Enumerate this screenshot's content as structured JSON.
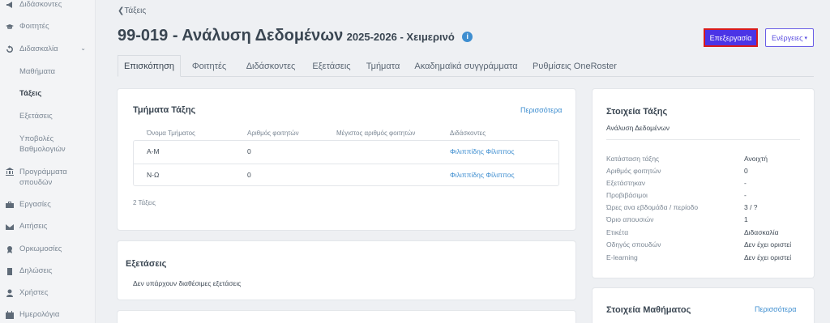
{
  "sidebar": {
    "items": [
      {
        "label": "Διδάσκοντες",
        "icon": "megaphone-icon"
      },
      {
        "label": "Φοιτητές",
        "icon": "graduation-cap-icon"
      },
      {
        "label": "Διδασκαλία",
        "icon": "refresh-icon"
      },
      {
        "label": "Προγράμματα σπουδών",
        "icon": "institution-icon"
      },
      {
        "label": "Εργασίες",
        "icon": "briefcase-icon"
      },
      {
        "label": "Αιτήσεις",
        "icon": "envelope-icon"
      },
      {
        "label": "Ορκωμοσίες",
        "icon": "certificate-icon"
      },
      {
        "label": "Δηλώσεις",
        "icon": "clipboard-icon"
      },
      {
        "label": "Χρήστες",
        "icon": "user-icon"
      },
      {
        "label": "Ημερολόγια",
        "icon": "calendar-icon"
      }
    ],
    "subitems": [
      "Μαθήματα",
      "Τάξεις",
      "Εξετάσεις",
      "Υποβολές Βαθμολογιών"
    ]
  },
  "header": {
    "back": "Τάξεις",
    "title": "99-019 - Ανάλυση Δεδομένων",
    "subtitle": "2025-2026 - Χειμερινό",
    "info": "i",
    "edit": "Επεξεργασία",
    "actions": "Ενέργειες",
    "actions_caret": "▾"
  },
  "tabs": [
    "Επισκόπηση",
    "Φοιτητές",
    "Διδάσκοντες",
    "Εξετάσεις",
    "Τμήματα",
    "Ακαδημαϊκά συγγράμματα",
    "Ρυθμίσεις OneRoster"
  ],
  "sections_card": {
    "title": "Τμήματα Τάξης",
    "more": "Περισσότερα",
    "columns": [
      "Όνομα Τμήματος",
      "Αριθμός φοιτητών",
      "Μέγιστος αριθμός φοιτητών",
      "Διδάσκοντες"
    ],
    "rows": [
      {
        "name": "Α-Μ",
        "students": "0",
        "max": "",
        "teacher": "Φιλιππίδης Φίλιππος"
      },
      {
        "name": "Ν-Ω",
        "students": "0",
        "max": "",
        "teacher": "Φιλιππίδης Φίλιππος"
      }
    ],
    "count": "2 Τάξεις"
  },
  "exams_card": {
    "title": "Εξετάσεις",
    "empty": "Δεν υπάρχουν διαθέσιμες εξετάσεις"
  },
  "class_card": {
    "title": "Στοιχεία Τάξης",
    "name": "Ανάλυση Δεδομένων",
    "rows": [
      {
        "label": "Κατάσταση τάξης",
        "value": "Ανοιχτή"
      },
      {
        "label": "Αριθμός φοιτητών",
        "value": "0"
      },
      {
        "label": "Εξετάστηκαν",
        "value": "-"
      },
      {
        "label": "Προβιβάσιμοι",
        "value": "-"
      },
      {
        "label": "Ώρες ανα εβδομάδα / περίοδο",
        "value": "3 / ?"
      },
      {
        "label": "Όριο απουσιών",
        "value": "1"
      },
      {
        "label": "Ετικέτα",
        "value": "Διδασκαλία"
      },
      {
        "label": "Οδηγός σπουδών",
        "value": "Δεν έχει οριστεί"
      },
      {
        "label": "E-learning",
        "value": "Δεν έχει οριστεί"
      }
    ]
  },
  "course_card": {
    "title": "Στοιχεία Μαθήματος",
    "more": "Περισσότερα"
  },
  "colors": {
    "primary": "#4b34e6",
    "link": "#3e8ed0",
    "highlight": "#d81b1b"
  }
}
